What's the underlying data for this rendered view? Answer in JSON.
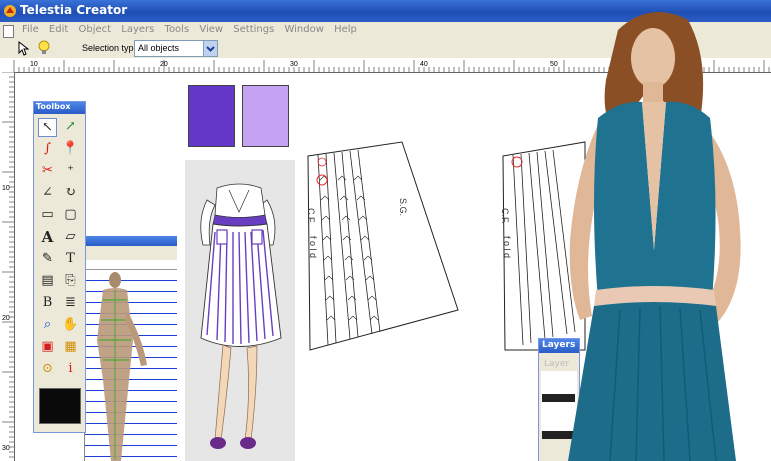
{
  "window": {
    "title": "Telestia Creator"
  },
  "menu": {
    "items": [
      "File",
      "Edit",
      "Object",
      "Layers",
      "Tools",
      "View",
      "Settings",
      "Window",
      "Help"
    ]
  },
  "toolbar": {
    "selection_type_label": "Selection type:",
    "selection_type_value": "All objects",
    "icons": [
      "pointer-icon",
      "lightbulb-icon"
    ]
  },
  "rulers": {
    "horizontal_labels": [
      "10",
      "20",
      "30",
      "40",
      "50"
    ],
    "vertical_labels": [
      "10",
      "20",
      "30"
    ]
  },
  "toolbox": {
    "title": "Toolbox",
    "tools": [
      "select-arrow-icon",
      "node-edit-icon",
      "curve-icon",
      "pin-icon",
      "cut-icon",
      "point-add-icon",
      "angle-icon",
      "rotate-icon",
      "rectangle-icon",
      "rounded-rect-icon",
      "text-icon",
      "parallelogram-icon",
      "pen-icon",
      "text-path-icon",
      "page-icon",
      "copy-icon",
      "object-b-icon",
      "layers-icon",
      "zoom-icon",
      "hand-icon",
      "frame-icon",
      "grade-icon",
      "measure-icon",
      "info-icon"
    ],
    "color": "#0a0a0a"
  },
  "swatches": [
    {
      "name": "dark-violet",
      "color": "#6437c8"
    },
    {
      "name": "light-violet",
      "color": "#c6a2f2"
    }
  ],
  "patterns": {
    "left": {
      "label_cf": "C.F.",
      "label_fold": "f o l d",
      "label_grain": "S.G."
    },
    "right": {
      "label_cf": "C.F.",
      "label_fold": "f o l d"
    }
  },
  "layers_window": {
    "title": "Layers",
    "subtitle": "Layer"
  },
  "colors": {
    "accent": "#2a5cc6",
    "dress": "#1f7391",
    "skirt_pleat": "#6a3ec0"
  }
}
